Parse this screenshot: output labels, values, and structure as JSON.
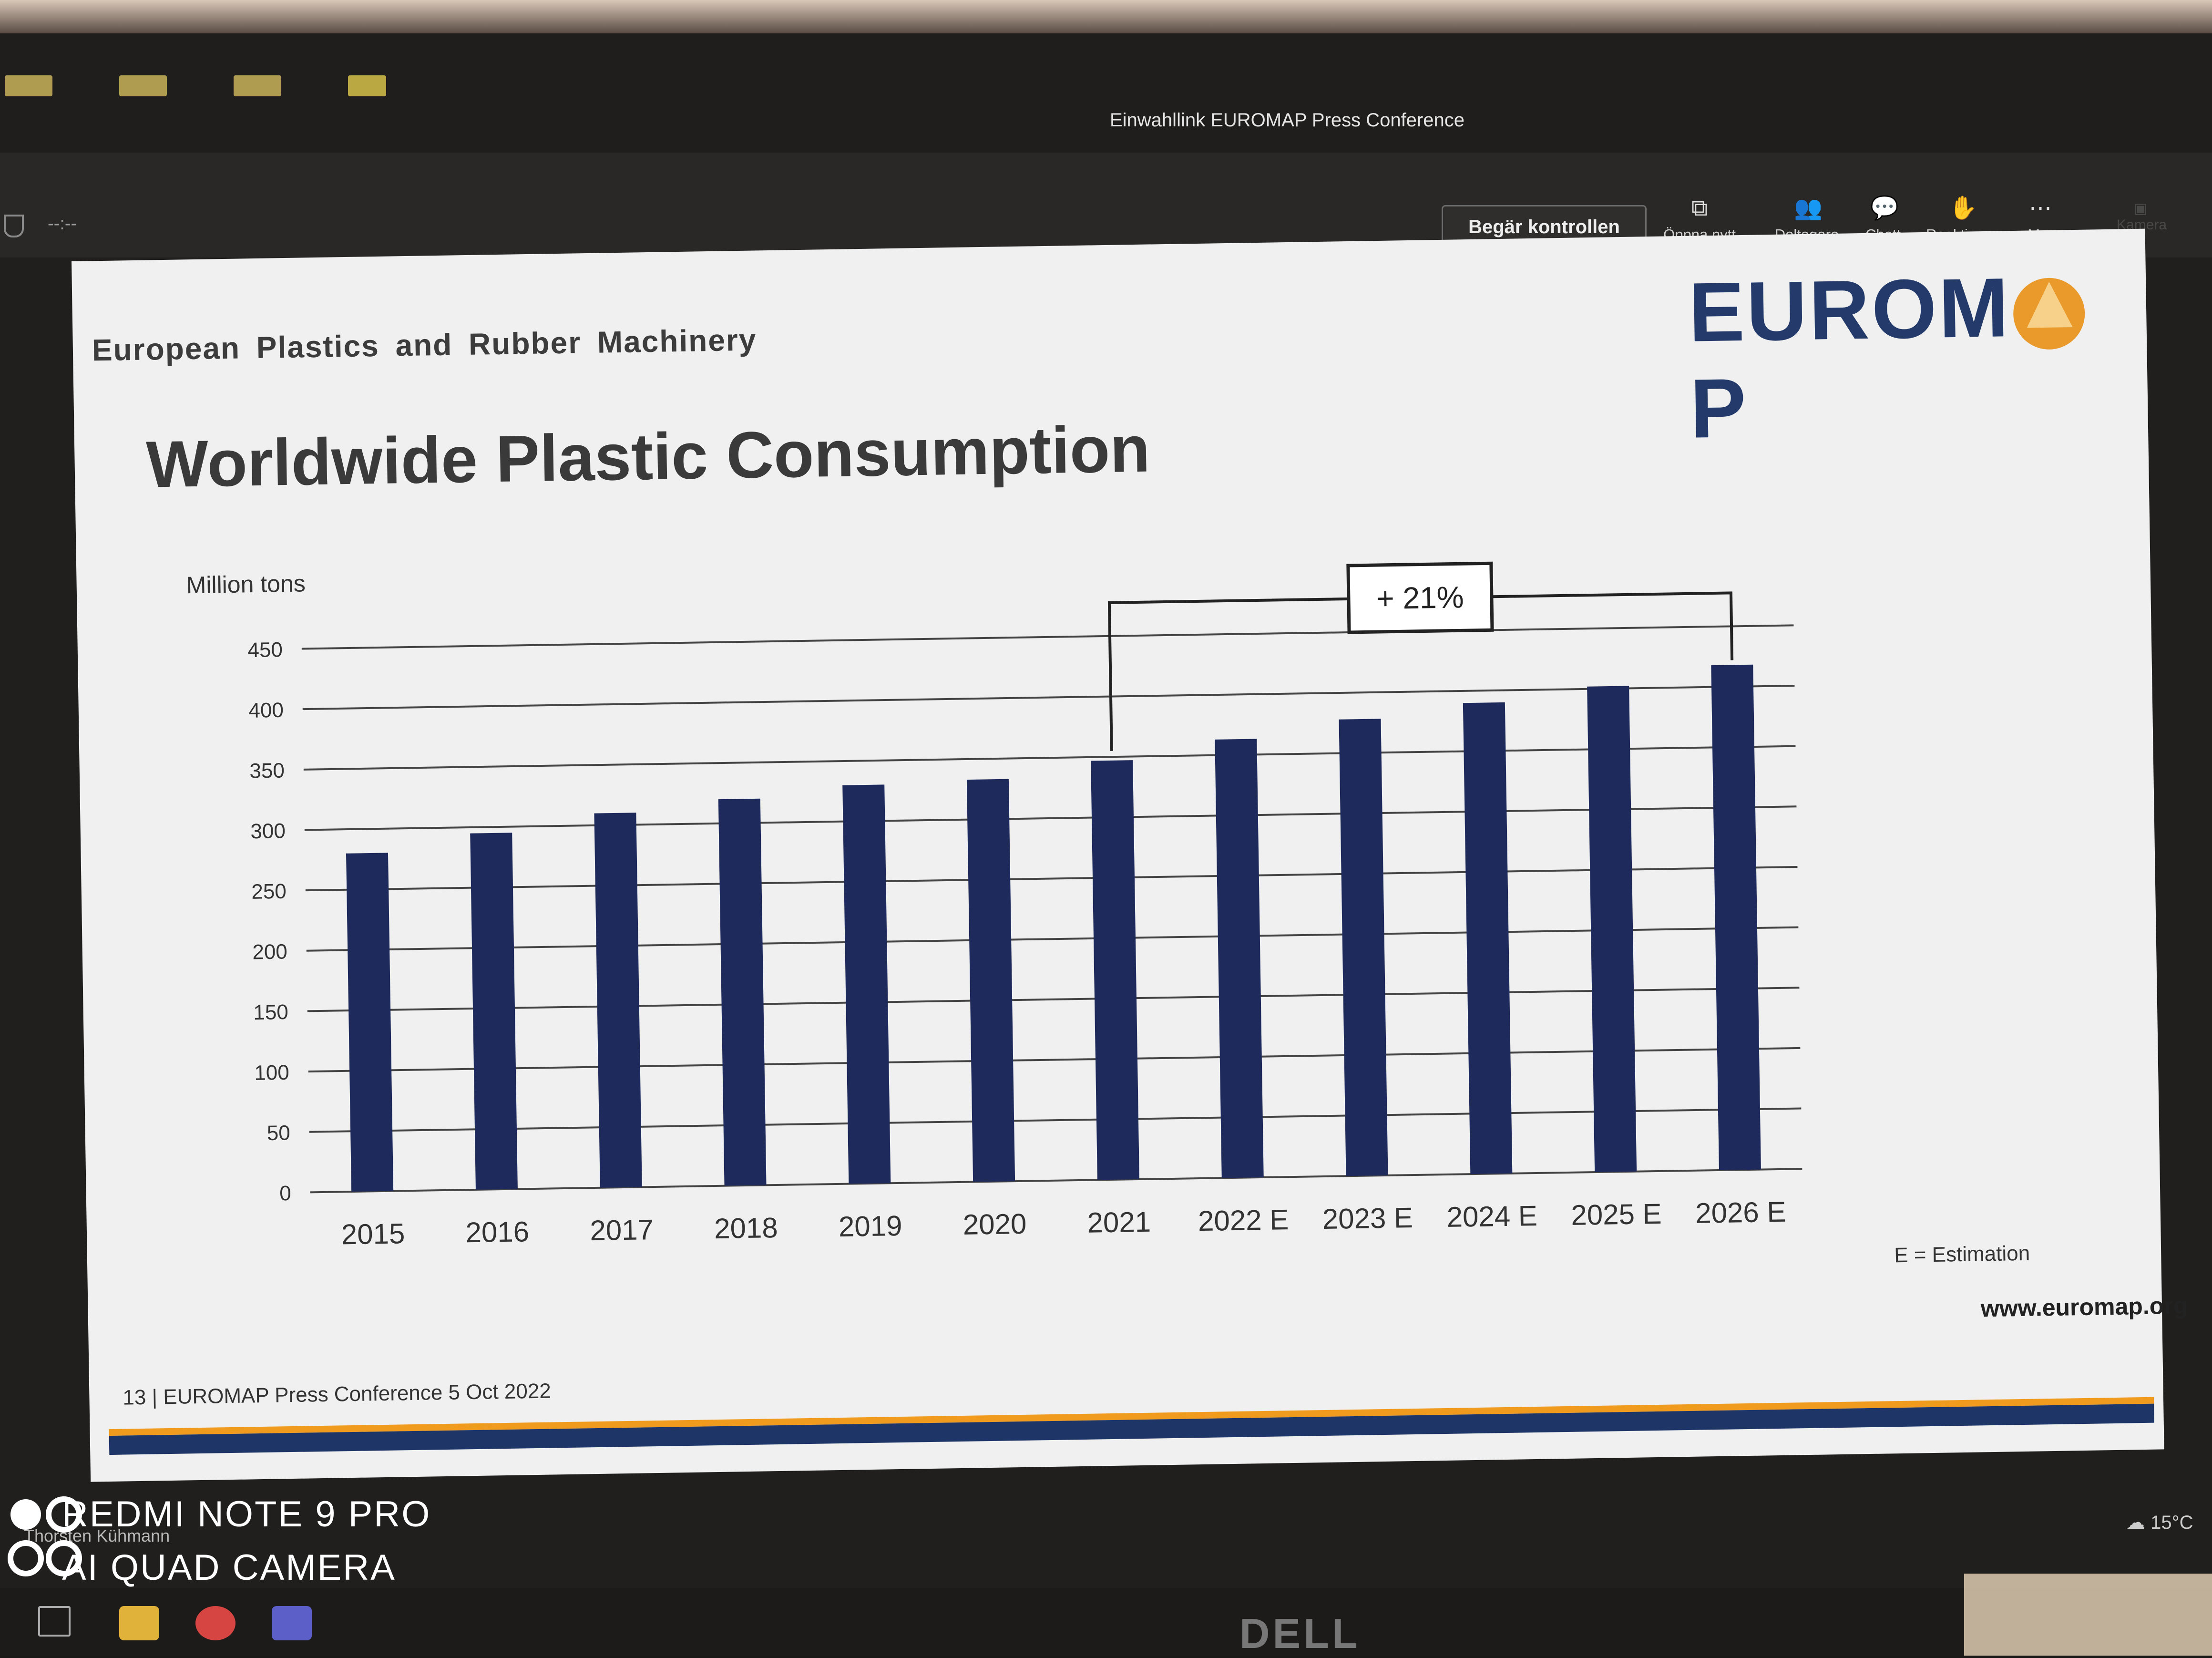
{
  "window": {
    "title": "Einwahllink EUROMAP Press Conference",
    "timer": "--:--"
  },
  "toolbar": {
    "request_control": "Begär kontrollen",
    "buttons": [
      {
        "label": "Öppna nytt",
        "icon": "open-new-icon"
      },
      {
        "label": "Deltagare",
        "icon": "participants-icon"
      },
      {
        "label": "Chatt",
        "icon": "chat-icon"
      },
      {
        "label": "Reaktioner",
        "icon": "reactions-icon"
      },
      {
        "label": "Mer",
        "icon": "more-icon"
      }
    ],
    "camera_label": "Kamera"
  },
  "slide": {
    "org_name": "European Plastics and Rubber Machinery",
    "logo_text_left": "EUROM",
    "logo_text_right": "P",
    "title": "Worldwide Plastic Consumption",
    "estimation_note": "E = Estimation",
    "website": "www.euromap.org",
    "footer": "13  |  EUROMAP Press Conference 5 Oct 2022",
    "accent_color": "#f09a1e",
    "brand_color": "#1e3568"
  },
  "chart_data": {
    "type": "bar",
    "ylabel": "Million tons",
    "ylim": [
      0,
      450
    ],
    "yticks": [
      0,
      50,
      100,
      150,
      200,
      250,
      300,
      350,
      400,
      450
    ],
    "grid": true,
    "categories": [
      "2015",
      "2016",
      "2017",
      "2018",
      "2019",
      "2020",
      "2021",
      "2022 E",
      "2023 E",
      "2024 E",
      "2025 E",
      "2026 E"
    ],
    "values": [
      280,
      295,
      310,
      320,
      330,
      333,
      347,
      363,
      378,
      390,
      402,
      418
    ],
    "bar_color": "#1f2a5c",
    "annotation": {
      "text": "+ 21%",
      "from": "2021",
      "to": "2026 E"
    }
  },
  "overlay": {
    "presenter": "Thorsten Kühmann",
    "watermark_line1": "REDMI NOTE 9 PRO",
    "watermark_line2": "AI QUAD CAMERA",
    "weather": "15°C",
    "device_brand": "DELL"
  }
}
